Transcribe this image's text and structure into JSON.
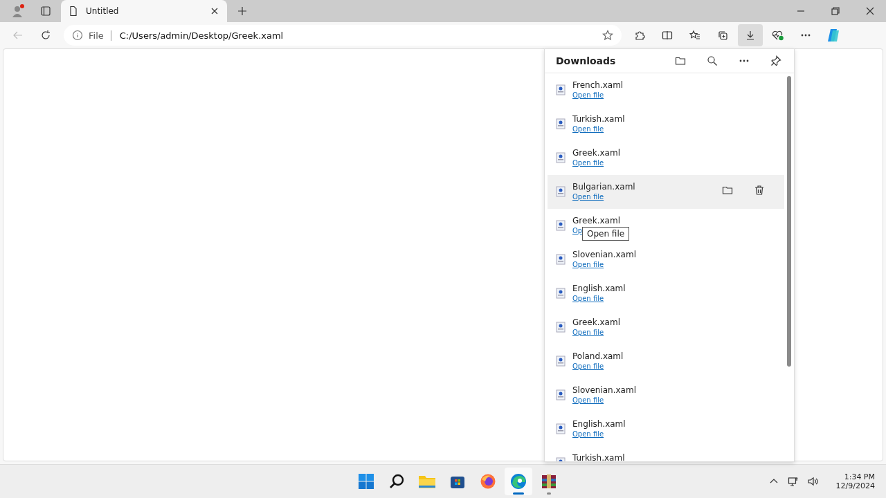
{
  "tabs": [
    {
      "title": "Untitled",
      "selected": true
    }
  ],
  "address_bar": {
    "scheme": "File",
    "url": "C:/Users/admin/Desktop/Greek.xaml"
  },
  "downloads": {
    "title": "Downloads",
    "items": [
      {
        "name": "French.xaml",
        "link": "Open file",
        "hovered": false
      },
      {
        "name": "Turkish.xaml",
        "link": "Open file",
        "hovered": false
      },
      {
        "name": "Greek.xaml",
        "link": "Open file",
        "hovered": false
      },
      {
        "name": "Bulgarian.xaml",
        "link": "Open file",
        "hovered": true
      },
      {
        "name": "Greek.xaml",
        "link": "Op",
        "hovered": false,
        "tooltip": "Open file"
      },
      {
        "name": "Slovenian.xaml",
        "link": "Open file",
        "hovered": false
      },
      {
        "name": "English.xaml",
        "link": "Open file",
        "hovered": false
      },
      {
        "name": "Greek.xaml",
        "link": "Open file",
        "hovered": false
      },
      {
        "name": "Poland.xaml",
        "link": "Open file",
        "hovered": false
      },
      {
        "name": "Slovenian.xaml",
        "link": "Open file",
        "hovered": false
      },
      {
        "name": "English.xaml",
        "link": "Open file",
        "hovered": false
      },
      {
        "name": "Turkish.xaml"
      }
    ]
  },
  "taskbar": {
    "apps": [
      {
        "kind": "start",
        "active": false
      },
      {
        "kind": "search",
        "active": false
      },
      {
        "kind": "files",
        "active": false
      },
      {
        "kind": "store",
        "active": false
      },
      {
        "kind": "firefox",
        "active": false
      },
      {
        "kind": "edge",
        "active": true
      },
      {
        "kind": "archiver",
        "active": false
      }
    ],
    "time": "1:34 PM",
    "date": "12/9/2024"
  }
}
